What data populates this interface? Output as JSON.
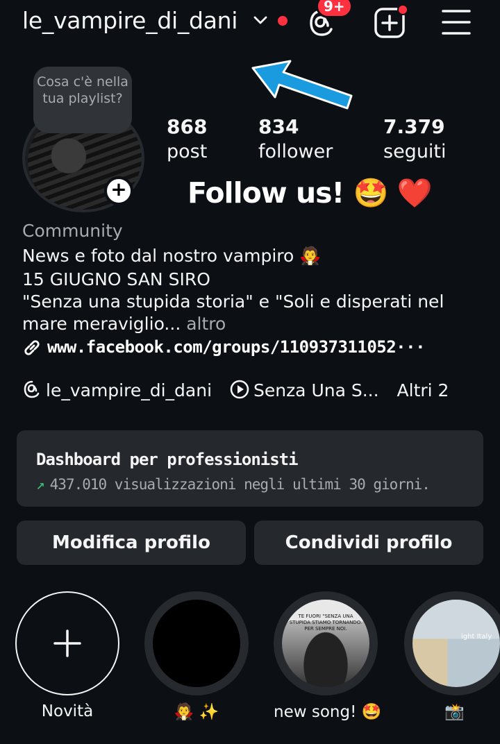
{
  "header": {
    "username": "le_vampire_di_dani",
    "threads_badge": "9+"
  },
  "profile": {
    "note": "Cosa c'è nella tua playlist?",
    "stats": [
      {
        "value": "868",
        "label": "post"
      },
      {
        "value": "834",
        "label": "follower"
      },
      {
        "value": "7.379",
        "label": "seguiti"
      }
    ],
    "overlay_text": "Follow us! 🤩 ❤️",
    "category": "Community",
    "bio_lines": [
      "News e foto dal nostro vampiro 🧛",
      "15 GIUGNO SAN SIRO",
      "\"Senza una stupida storia\" e \"Soli e disperati nel",
      "mare meraviglio..."
    ],
    "bio_more": "altro",
    "link": "www.facebook.com/groups/110937311052···",
    "chips": [
      {
        "icon": "threads-icon",
        "label": "le_vampire_di_dani"
      },
      {
        "icon": "play-icon",
        "label": "Senza Una S..."
      },
      {
        "icon": "",
        "label": "Altri 2"
      }
    ]
  },
  "dashboard": {
    "title": "Dashboard per professionisti",
    "arrow": "↗",
    "subtitle": "437.010 visualizzazioni negli ultimi 30 giorni."
  },
  "buttons": {
    "edit": "Modifica profilo",
    "share": "Condividi profilo"
  },
  "highlights": [
    {
      "label": "Novità",
      "plus": "+"
    },
    {
      "label": "🧛 ✨"
    },
    {
      "label": "new song! 🤩",
      "inner_text": "TE FUORI \"SENZA UNA STUPIDA STIAMO TORNANDO. PER SEMPRE NOI."
    },
    {
      "label": "📸",
      "inner_text": "ight Italy"
    }
  ],
  "colors": {
    "background": "#0c1014",
    "card": "#25292e",
    "notification_red": "#ff3040",
    "arrow_blue": "#1a9be0",
    "trend_green": "#3cc67b"
  }
}
